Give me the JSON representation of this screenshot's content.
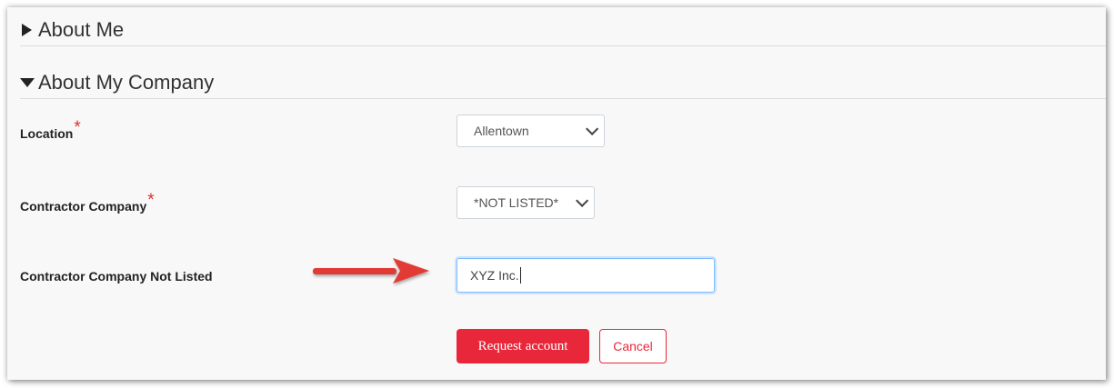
{
  "sections": {
    "about_me": {
      "label": "About Me",
      "expanded": false
    },
    "about_company": {
      "label": "About My Company",
      "expanded": true
    }
  },
  "form": {
    "location": {
      "label": "Location",
      "required_mark": "*",
      "value": "Allentown"
    },
    "contractor_company": {
      "label": "Contractor Company",
      "required_mark": "*",
      "value": "*NOT LISTED*"
    },
    "contractor_not_listed": {
      "label": "Contractor Company Not Listed",
      "value": "XYZ Inc."
    }
  },
  "buttons": {
    "request": "Request account",
    "cancel": "Cancel"
  },
  "colors": {
    "accent": "#e8283a",
    "annotation_arrow": "#e23a35",
    "focus_border": "#80bdff"
  }
}
